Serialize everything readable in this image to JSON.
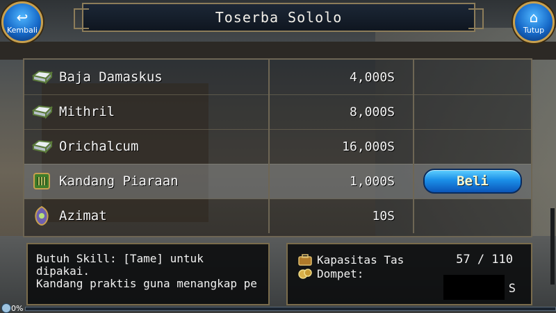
{
  "window": {
    "title": "Toserba Sololo"
  },
  "nav": {
    "back_label": "Kembali",
    "back_icon": "return-arrow-icon",
    "close_label": "Tutup",
    "close_icon": "home-icon"
  },
  "items": [
    {
      "name": "Baja Damaskus",
      "price": "4,000S",
      "icon": "ingot-icon"
    },
    {
      "name": "Mithril",
      "price": "8,000S",
      "icon": "ingot-icon"
    },
    {
      "name": "Orichalcum",
      "price": "16,000S",
      "icon": "ingot-icon"
    },
    {
      "name": "Kandang Piaraan",
      "price": "1,000S",
      "icon": "pet-cage-icon",
      "selected": true,
      "action_label": "Beli"
    },
    {
      "name": "Azimat",
      "price": "10S",
      "icon": "amulet-icon"
    }
  ],
  "description": {
    "text": "Butuh Skill: [Tame] untuk\ndipakai.\nKandang praktis guna menangkap pe"
  },
  "inventory": {
    "capacity_label": "Kapasitas Tas",
    "capacity_value": "57 / 110",
    "wallet_label": "Dompet:",
    "wallet_unit": "S"
  },
  "footer": {
    "progress_text": "0%"
  },
  "colors": {
    "accent": "#1b8fe8",
    "frame": "#8d7d5a",
    "buy_text": "#fffbd0"
  }
}
